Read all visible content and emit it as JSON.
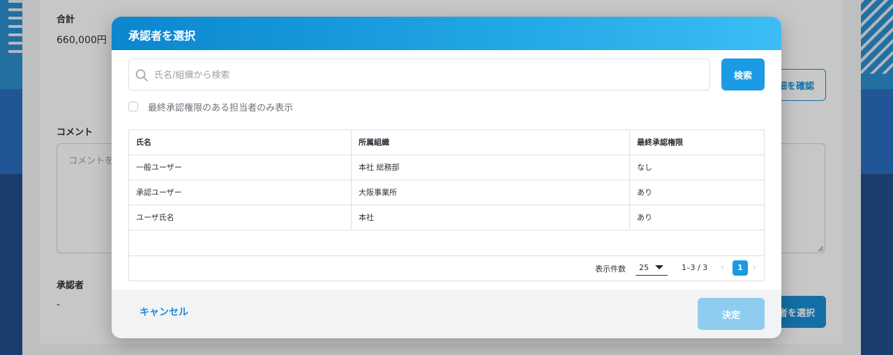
{
  "background": {
    "total_label": "合計",
    "total_value": "660,000円",
    "comment_label": "コメント",
    "comment_placeholder": "コメントを入",
    "approver_label": "承認者",
    "approver_value": "-",
    "detail_button_partial": "細を確認",
    "select_approver_button_partial": "者を選択"
  },
  "modal": {
    "title": "承認者を選択",
    "search": {
      "placeholder": "氏名/組織から検索",
      "button_label": "検索"
    },
    "filter": {
      "checkbox_label": "最終承認権限のある担当者のみ表示",
      "checked": false
    },
    "table": {
      "columns": [
        "氏名",
        "所属組織",
        "最終承認権限"
      ],
      "rows": [
        [
          "一般ユーザー",
          "本社 総務部",
          "なし"
        ],
        [
          "承認ユーザー",
          "大阪事業所",
          "あり"
        ],
        [
          "ユーザ氏名",
          "本社",
          "あり"
        ]
      ]
    },
    "pagination": {
      "per_page_label": "表示件数",
      "per_page_value": "25",
      "range": "1–3 / 3",
      "current_page": "1",
      "prev_icon": "‹",
      "next_icon": "›"
    },
    "footer": {
      "cancel_label": "キャンセル",
      "confirm_label": "決定"
    }
  },
  "colors": {
    "accent": "#1a9be3",
    "header_gradient_start": "#0b86cf",
    "header_gradient_end": "#3cbdf5",
    "confirm_disabled": "#8fcdf0"
  }
}
